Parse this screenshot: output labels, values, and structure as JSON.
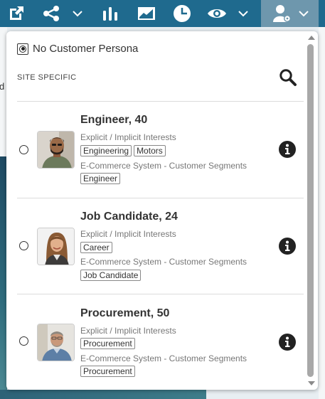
{
  "toolbar": {
    "icons": [
      "external-link-icon",
      "share-icon",
      "chevron-down-icon",
      "bar-chart-icon",
      "line-chart-icon",
      "pie-chart-icon",
      "eye-icon",
      "chevron-down-icon",
      "persona-settings-icon",
      "chevron-down-icon"
    ],
    "colors": {
      "background": "#1f6a8e",
      "active": "#6e97ad"
    }
  },
  "background": {
    "left_fragment": "d"
  },
  "panel": {
    "no_persona_label": "No Customer Persona",
    "section_heading": "SITE SPECIFIC",
    "personas": [
      {
        "name": "Engineer, 40",
        "interests_label": "Explicit / Implicit Interests",
        "interest_tags": [
          "Engineering",
          "Motors"
        ],
        "segments_label": "E-Commerce System - Customer Segments",
        "segment_tags": [
          "Engineer"
        ],
        "selected": false
      },
      {
        "name": "Job Candidate, 24",
        "interests_label": "Explicit / Implicit Interests",
        "interest_tags": [
          "Career"
        ],
        "segments_label": "E-Commerce System - Customer Segments",
        "segment_tags": [
          "Job Candidate"
        ],
        "selected": false
      },
      {
        "name": "Procurement, 50",
        "interests_label": "Explicit / Implicit Interests",
        "interest_tags": [
          "Procurement"
        ],
        "segments_label": "E-Commerce System - Customer Segments",
        "segment_tags": [
          "Procurement"
        ],
        "selected": false
      }
    ]
  }
}
